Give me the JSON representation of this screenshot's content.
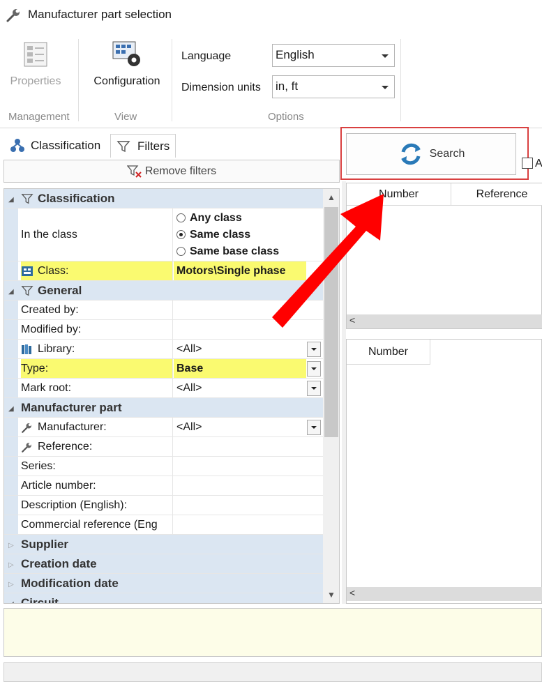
{
  "window": {
    "title": "Manufacturer part selection"
  },
  "ribbon": {
    "properties_label": "Properties",
    "configuration_label": "Configuration",
    "group_management": "Management",
    "group_view": "View",
    "group_options": "Options",
    "language_label": "Language",
    "language_value": "English",
    "units_label": "Dimension units",
    "units_value": "in, ft"
  },
  "tabs": {
    "classification": "Classification",
    "filters": "Filters"
  },
  "remove_filters": "Remove filters",
  "grid": {
    "classification_title": "Classification",
    "in_class_label": "In the class",
    "radio_any": "Any class",
    "radio_same": "Same class",
    "radio_base": "Same base class",
    "class_label": "Class:",
    "class_value": "Motors\\Single phase",
    "general_title": "General",
    "created_by": "Created by:",
    "modified_by": "Modified by:",
    "library_label": "Library:",
    "library_value": "<All>",
    "type_label": "Type:",
    "type_value": "Base",
    "mark_root_label": "Mark root:",
    "mark_root_value": "<All>",
    "manufacturer_part_title": "Manufacturer part",
    "manufacturer_label": "Manufacturer:",
    "manufacturer_value": "<All>",
    "reference_label": "Reference:",
    "series_label": "Series:",
    "article_label": "Article number:",
    "description_label": "Description (English):",
    "commercial_label": "Commercial reference (Eng",
    "supplier_title": "Supplier",
    "creation_date_title": "Creation date",
    "modification_date_title": "Modification date",
    "circuit_title": "Circuit"
  },
  "right": {
    "search_label": "Search",
    "check_label": "A",
    "list1_col_number": "Number",
    "list1_col_reference": "Reference",
    "list2_col_number": "Number"
  },
  "colors": {
    "highlight": "#fafa70",
    "section_bg": "#dbe6f2",
    "annotation_red": "#ff0000"
  }
}
